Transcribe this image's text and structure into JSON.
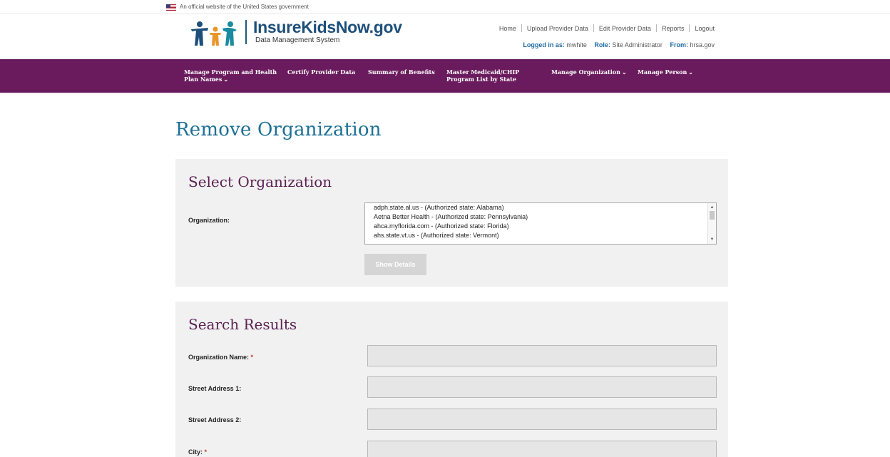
{
  "gov_banner": {
    "text": "An official website of the United States government"
  },
  "brand": {
    "title": "InsureKidsNow.gov",
    "subtitle": "Data Management System"
  },
  "utility_links": [
    "Home",
    "Upload Provider Data",
    "Edit Provider Data",
    "Reports",
    "Logout"
  ],
  "login": {
    "logged_in_label": "Logged in as:",
    "logged_in_value": "mwhite",
    "role_label": "Role:",
    "role_value": "Site Administrator",
    "from_label": "From:",
    "from_value": "hrsa.gov"
  },
  "nav": {
    "manage_program": {
      "line1": "Manage Program and Health",
      "line2": "Plan Names"
    },
    "certify": "Certify Provider Data",
    "summary": "Summary of Benefits",
    "master": {
      "line1": "Master Medicaid/CHIP",
      "line2": "Program List by State"
    },
    "manage_org": "Manage Organization",
    "manage_person": "Manage Person"
  },
  "page_title": "Remove Organization",
  "select_panel": {
    "heading": "Select Organization",
    "org_label": "Organization:",
    "options": [
      "adph.state.al.us - (Authorized state: Alabama)",
      "Aetna Better Health - (Authorized state: Pennsylvania)",
      "ahca.myflorida.com - (Authorized state: Florida)",
      "ahs.state.vt.us - (Authorized state: Vermont)"
    ],
    "show_details": "Show Details"
  },
  "results_panel": {
    "heading": "Search Results",
    "fields": {
      "org_name": "Organization Name:",
      "street1": "Street Address 1:",
      "street2": "Street Address 2:",
      "city": "City:"
    },
    "required_mark": "*"
  },
  "colors": {
    "nav_purple": "#6a1b5d",
    "title_blue": "#1b6f94",
    "heading_purple": "#5b2152"
  }
}
